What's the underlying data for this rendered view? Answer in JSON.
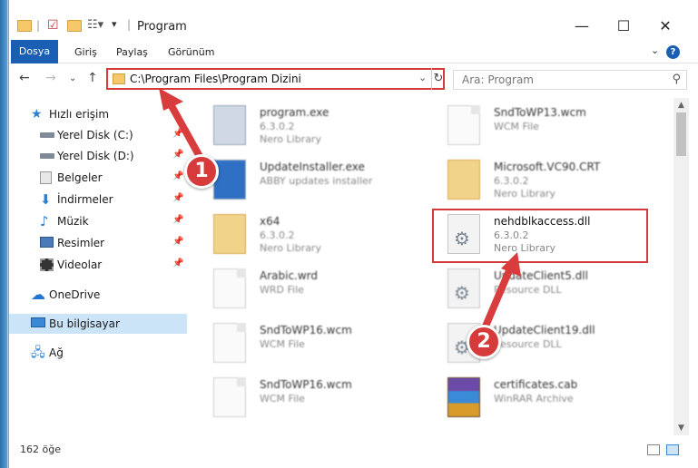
{
  "window": {
    "title": "Program",
    "controls": {
      "minimize": "—",
      "maximize": "☐",
      "close": "✕"
    }
  },
  "ribbon": {
    "tabs": [
      "Dosya",
      "Giriş",
      "Paylaş",
      "Görünüm"
    ],
    "help": "?"
  },
  "address": {
    "path": "C:\\Program Files\\Program Dizini",
    "search_placeholder": "Ara: Program"
  },
  "nav": {
    "quick_access": "Hızlı erişim",
    "items": [
      "Yerel Disk (C:)",
      "Yerel Disk (D:)",
      "Belgeler",
      "İndirmeler",
      "Müzik",
      "Resimler",
      "Videolar"
    ],
    "onedrive": "OneDrive",
    "this_pc": "Bu bilgisayar",
    "network": "Ağ"
  },
  "files": [
    {
      "name": "program.exe",
      "line2": "6.3.0.2",
      "line3": "Nero Library",
      "kind": "exe"
    },
    {
      "name": "SndToWP13.wcm",
      "line2": "WCM File",
      "line3": "",
      "kind": "page"
    },
    {
      "name": "UpdateInstaller.exe",
      "line2": "ABBY updates installer",
      "line3": "",
      "kind": "exe"
    },
    {
      "name": "Microsoft.VC90.CRT",
      "line2": "6.3.0.2",
      "line3": "Nero Library",
      "kind": "folder"
    },
    {
      "name": "x64",
      "line2": "6.3.0.2",
      "line3": "Nero Library",
      "kind": "folder"
    },
    {
      "name": "nehdblkaccess.dll",
      "line2": "6.3.0.2",
      "line3": "Nero Library",
      "kind": "dll"
    },
    {
      "name": "Arabic.wrd",
      "line2": "WRD File",
      "line3": "",
      "kind": "page"
    },
    {
      "name": "UpdateClient5.dll",
      "line2": "Resource DLL",
      "line3": "",
      "kind": "dll"
    },
    {
      "name": "SndToWP16.wcm",
      "line2": "WCM File",
      "line3": "",
      "kind": "page"
    },
    {
      "name": "UpdateClient19.dll",
      "line2": "Resource DLL",
      "line3": "",
      "kind": "dll"
    },
    {
      "name": "SndToWP16.wcm",
      "line2": "WCM File",
      "line3": "",
      "kind": "page"
    },
    {
      "name": "certificates.cab",
      "line2": "WinRAR Archive",
      "line3": "",
      "kind": "cab"
    }
  ],
  "annotations": {
    "step1": "1",
    "step2": "2"
  },
  "status": {
    "count": "162 öğe"
  },
  "colors": {
    "accent": "#1a5fb4",
    "highlight": "#d33b3b",
    "selection": "#cce4f7"
  }
}
